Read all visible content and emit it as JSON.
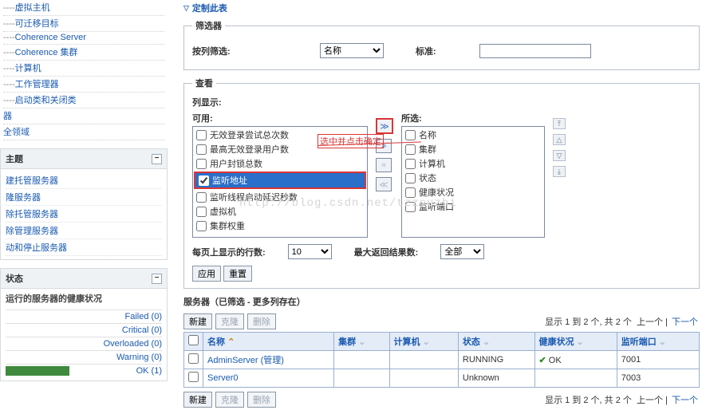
{
  "sidebar": {
    "tree": [
      "虚拟主机",
      "可迁移目标",
      "Coherence Server",
      "Coherence 集群",
      "计算机",
      "工作管理器",
      "启动类和关闭类"
    ],
    "tree_tail": [
      "器",
      "全领域"
    ],
    "topic_head": "主题",
    "topic_items": [
      "建托管服务器",
      "隆服务器",
      "除托管服务器",
      "除管理服务器",
      "动和停止服务器"
    ],
    "status_head": "状态",
    "status_desc": "运行的服务器的健康状况",
    "statuses": [
      {
        "label": "Failed (0)",
        "cls": "failed"
      },
      {
        "label": "Critical (0)",
        "cls": "critical"
      },
      {
        "label": "Overloaded (0)",
        "cls": "overloaded"
      },
      {
        "label": "Warning (0)",
        "cls": "warning"
      },
      {
        "label": "OK (1)",
        "cls": "ok"
      }
    ]
  },
  "main": {
    "customize": "定制此表",
    "filter_legend": "筛选器",
    "filter_bycol": "按列筛选:",
    "filter_select": "名称",
    "filter_std": "标准:",
    "view_legend": "查看",
    "cols_label": "列显示:",
    "avail_label": "可用:",
    "chosen_label": "所选:",
    "available_items": [
      {
        "label": "无效登录尝试总次数",
        "sel": false
      },
      {
        "label": "最高无效登录用户数",
        "sel": false
      },
      {
        "label": "用户封锁总数",
        "sel": false
      },
      {
        "label": "监听地址",
        "sel": true
      },
      {
        "label": "监听线程启动延迟秒数",
        "sel": false
      },
      {
        "label": "虚拟机",
        "sel": false
      },
      {
        "label": "集群权重",
        "sel": false
      }
    ],
    "chosen_items": [
      "名称",
      "集群",
      "计算机",
      "状态",
      "健康状况",
      "监听端口"
    ],
    "rows_label": "每页上显示的行数:",
    "rows_value": "10",
    "maxret_label": "最大返回结果数:",
    "maxret_value": "全部",
    "btn_apply": "应用",
    "btn_reset": "重置",
    "servers_title": "服务器（已筛选 - 更多列存在）",
    "btn_new": "新建",
    "btn_clone": "克隆",
    "btn_delete": "删除",
    "pager": "显示 1 到 2 个, 共 2 个",
    "pager_prev": "上一个",
    "pager_next": "下一个",
    "table": {
      "headers": [
        "名称",
        "集群",
        "计算机",
        "状态",
        "健康状况",
        "监听端口"
      ],
      "rows": [
        {
          "name": "AdminServer (管理)",
          "cluster": "",
          "machine": "",
          "state": "RUNNING",
          "health": "OK",
          "port": "7001",
          "ok": true
        },
        {
          "name": "Server0",
          "cluster": "",
          "machine": "",
          "state": "Unknown",
          "health": "",
          "port": "7003",
          "ok": false
        }
      ]
    },
    "annotation": "选中并点击确定",
    "watermark": "http://blog.csdn.net/tzzouzhi"
  }
}
